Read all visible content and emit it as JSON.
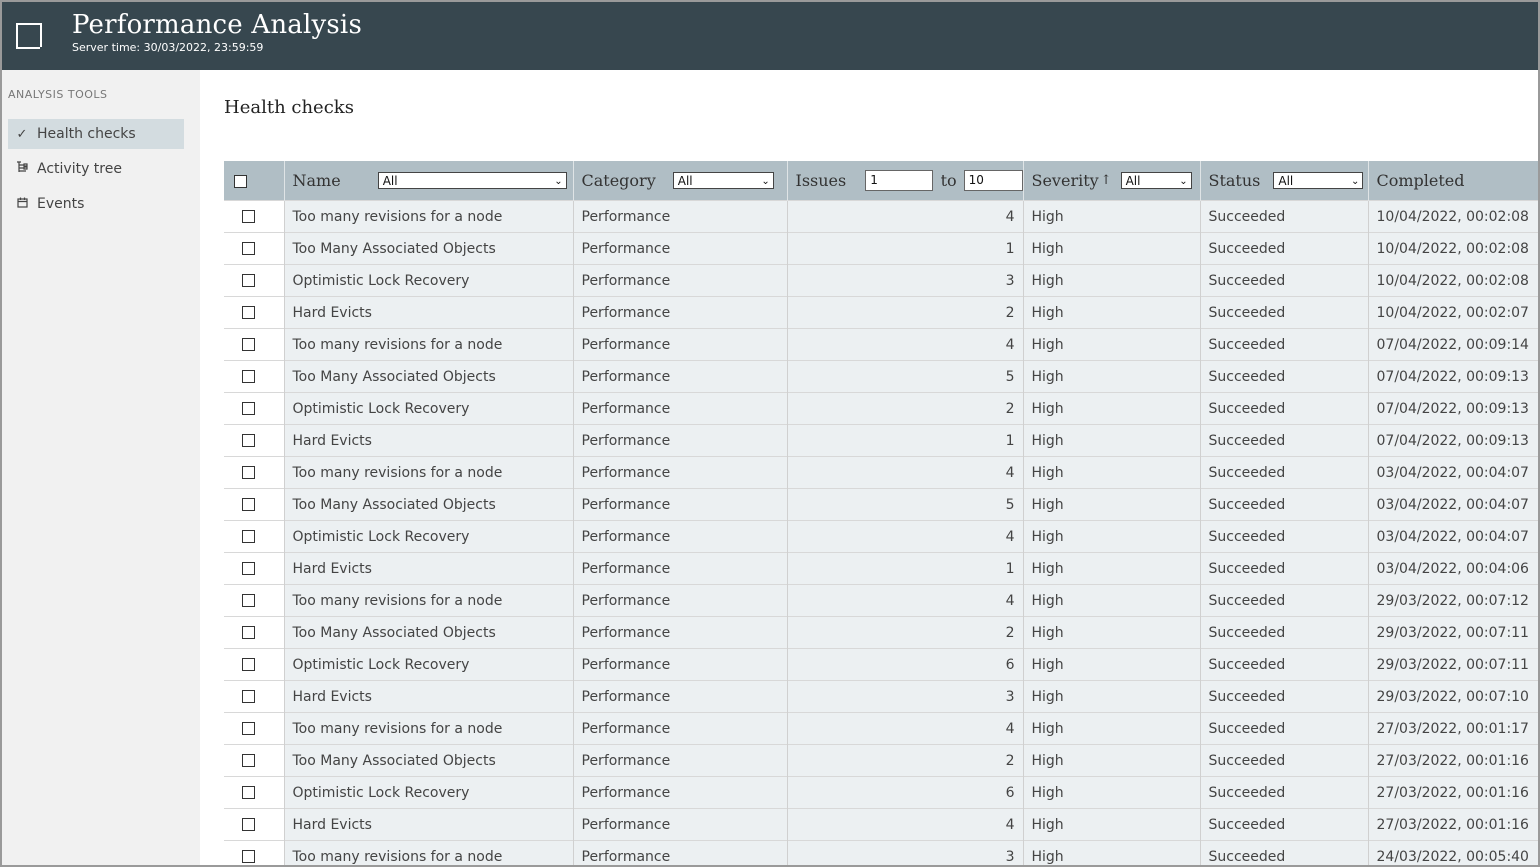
{
  "header": {
    "title": "Performance Analysis",
    "server_time": "Server time: 30/03/2022, 23:59:59"
  },
  "sidebar": {
    "heading": "ANALYSIS TOOLS",
    "items": [
      {
        "label": "Health checks",
        "icon": "check-icon",
        "active": true
      },
      {
        "label": "Activity tree",
        "icon": "tree-icon",
        "active": false
      },
      {
        "label": "Events",
        "icon": "calendar-icon",
        "active": false
      }
    ]
  },
  "main": {
    "title": "Health checks"
  },
  "table": {
    "columns": {
      "name": "Name",
      "category": "Category",
      "issues": "Issues",
      "issues_to": "to",
      "severity": "Severity",
      "status": "Status",
      "completed": "Completed"
    },
    "filters": {
      "name": "All",
      "category": "All",
      "issues_min": "1",
      "issues_max": "10",
      "severity": "All",
      "status": "All"
    },
    "rows": [
      {
        "name": "Too many revisions for a node",
        "category": "Performance",
        "issues": "4",
        "severity": "High",
        "status": "Succeeded",
        "completed": "10/04/2022, 00:02:08"
      },
      {
        "name": "Too Many Associated Objects",
        "category": "Performance",
        "issues": "1",
        "severity": "High",
        "status": "Succeeded",
        "completed": "10/04/2022, 00:02:08"
      },
      {
        "name": "Optimistic Lock Recovery",
        "category": "Performance",
        "issues": "3",
        "severity": "High",
        "status": "Succeeded",
        "completed": "10/04/2022, 00:02:08"
      },
      {
        "name": "Hard Evicts",
        "category": "Performance",
        "issues": "2",
        "severity": "High",
        "status": "Succeeded",
        "completed": "10/04/2022, 00:02:07"
      },
      {
        "name": "Too many revisions for a node",
        "category": "Performance",
        "issues": "4",
        "severity": "High",
        "status": "Succeeded",
        "completed": "07/04/2022, 00:09:14"
      },
      {
        "name": "Too Many Associated Objects",
        "category": "Performance",
        "issues": "5",
        "severity": "High",
        "status": "Succeeded",
        "completed": "07/04/2022, 00:09:13"
      },
      {
        "name": "Optimistic Lock Recovery",
        "category": "Performance",
        "issues": "2",
        "severity": "High",
        "status": "Succeeded",
        "completed": "07/04/2022, 00:09:13"
      },
      {
        "name": "Hard Evicts",
        "category": "Performance",
        "issues": "1",
        "severity": "High",
        "status": "Succeeded",
        "completed": "07/04/2022, 00:09:13"
      },
      {
        "name": "Too many revisions for a node",
        "category": "Performance",
        "issues": "4",
        "severity": "High",
        "status": "Succeeded",
        "completed": "03/04/2022, 00:04:07"
      },
      {
        "name": "Too Many Associated Objects",
        "category": "Performance",
        "issues": "5",
        "severity": "High",
        "status": "Succeeded",
        "completed": "03/04/2022, 00:04:07"
      },
      {
        "name": "Optimistic Lock Recovery",
        "category": "Performance",
        "issues": "4",
        "severity": "High",
        "status": "Succeeded",
        "completed": "03/04/2022, 00:04:07"
      },
      {
        "name": "Hard Evicts",
        "category": "Performance",
        "issues": "1",
        "severity": "High",
        "status": "Succeeded",
        "completed": "03/04/2022, 00:04:06"
      },
      {
        "name": "Too many revisions for a node",
        "category": "Performance",
        "issues": "4",
        "severity": "High",
        "status": "Succeeded",
        "completed": "29/03/2022, 00:07:12"
      },
      {
        "name": "Too Many Associated Objects",
        "category": "Performance",
        "issues": "2",
        "severity": "High",
        "status": "Succeeded",
        "completed": "29/03/2022, 00:07:11"
      },
      {
        "name": "Optimistic Lock Recovery",
        "category": "Performance",
        "issues": "6",
        "severity": "High",
        "status": "Succeeded",
        "completed": "29/03/2022, 00:07:11"
      },
      {
        "name": "Hard Evicts",
        "category": "Performance",
        "issues": "3",
        "severity": "High",
        "status": "Succeeded",
        "completed": "29/03/2022, 00:07:10"
      },
      {
        "name": "Too many revisions for a node",
        "category": "Performance",
        "issues": "4",
        "severity": "High",
        "status": "Succeeded",
        "completed": "27/03/2022, 00:01:17"
      },
      {
        "name": "Too Many Associated Objects",
        "category": "Performance",
        "issues": "2",
        "severity": "High",
        "status": "Succeeded",
        "completed": "27/03/2022, 00:01:16"
      },
      {
        "name": "Optimistic Lock Recovery",
        "category": "Performance",
        "issues": "6",
        "severity": "High",
        "status": "Succeeded",
        "completed": "27/03/2022, 00:01:16"
      },
      {
        "name": "Hard Evicts",
        "category": "Performance",
        "issues": "4",
        "severity": "High",
        "status": "Succeeded",
        "completed": "27/03/2022, 00:01:16"
      },
      {
        "name": "Too many revisions for a node",
        "category": "Performance",
        "issues": "3",
        "severity": "High",
        "status": "Succeeded",
        "completed": "24/03/2022, 00:05:40"
      }
    ]
  }
}
